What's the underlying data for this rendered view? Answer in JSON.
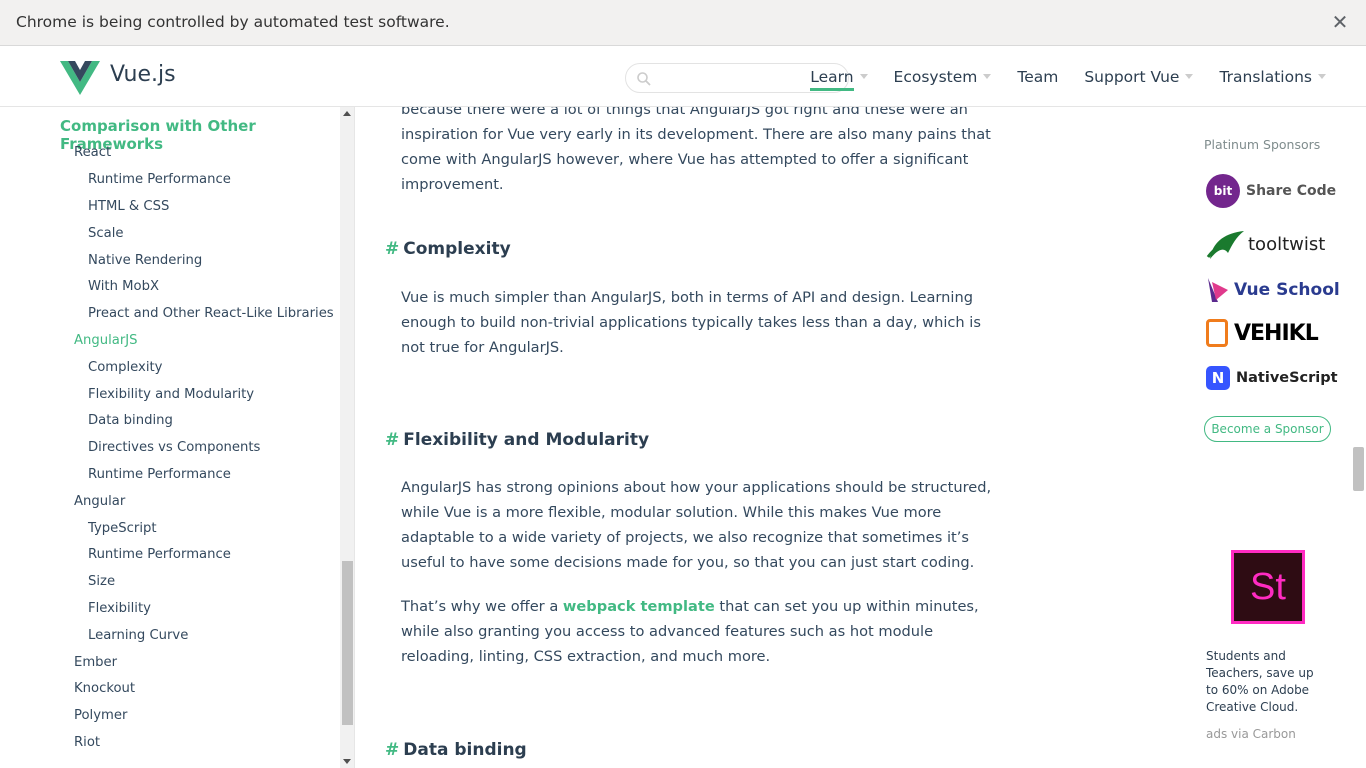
{
  "infobar": {
    "text": "Chrome is being controlled by automated test software.",
    "close": "✕"
  },
  "header": {
    "brand": "Vue.js",
    "search_placeholder": "",
    "nav": [
      {
        "label": "Learn",
        "active": true
      },
      {
        "label": "Ecosystem"
      },
      {
        "label": "Team"
      },
      {
        "label": "Support Vue"
      },
      {
        "label": "Translations"
      }
    ],
    "accent": "#42b983"
  },
  "sidebar": {
    "heading": "Comparison with Other Frameworks",
    "items": [
      "React",
      "Runtime Performance",
      "HTML & CSS",
      "Scale",
      "Native Rendering",
      "With MobX",
      "Preact and Other React-Like Libraries",
      "AngularJS",
      "Complexity",
      "Flexibility and Modularity",
      "Data binding",
      "Directives vs Components",
      "Runtime Performance",
      "Angular",
      "TypeScript",
      "Runtime Performance",
      "Size",
      "Flexibility",
      "Learning Curve",
      "Ember",
      "Knockout",
      "Polymer",
      "Riot"
    ]
  },
  "content": {
    "intro": "because there were a lot of things that AngularJS got right and these were an inspiration for Vue very early in its development. There are also many pains that come with AngularJS however, where Vue has attempted to offer a significant improvement.",
    "sections": [
      {
        "title": "Complexity",
        "hash": "#",
        "body": "Vue is much simpler than AngularJS, both in terms of API and design. Learning enough to build non-trivial applications typically takes less than a day, which is not true for AngularJS."
      },
      {
        "title": "Flexibility and Modularity",
        "hash": "#",
        "body": "AngularJS has strong opinions about how your applications should be structured, while Vue is a more flexible, modular solution. While this makes Vue more adaptable to a wide variety of projects, we also recognize that sometimes it’s useful to have some decisions made for you, so that you can just start coding.",
        "body2_pre": "That’s why we offer a ",
        "body2_link": "webpack template",
        "body2_post": " that can set you up within minutes, while also granting you access to advanced features such as hot module reloading, linting, CSS extraction, and much more."
      },
      {
        "title": "Data binding",
        "hash": "#"
      }
    ]
  },
  "sponsors": {
    "title": "Platinum Sponsors",
    "list": [
      {
        "name": "Share Code",
        "badge": "bit",
        "color": "#73268d"
      },
      {
        "name": "tooltwist",
        "color": "#1a7a2e"
      },
      {
        "name": "Vue School",
        "color": "#2a3b8f"
      },
      {
        "name": "VEHIKL",
        "color": "#000000"
      },
      {
        "name": "NativeScript",
        "color": "#3655ff"
      }
    ],
    "become": "Become a Sponsor",
    "ad_logo": "St",
    "ad_text": "Students and Teachers, save up to 60% on Adobe Creative Cloud.",
    "ad_via": "ads via Carbon"
  }
}
